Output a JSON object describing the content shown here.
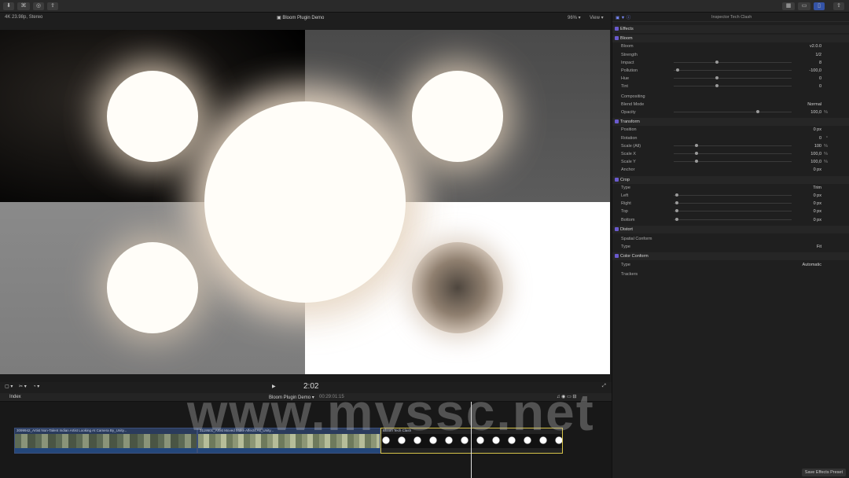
{
  "viewer": {
    "format": "4K 23.98p, Stereo",
    "title": "Bloom Plugin Demo",
    "zoom": "96%",
    "view_label": "View"
  },
  "inspector": {
    "title": "Inspector Tech Clash",
    "sections": [
      {
        "label": "Effects",
        "type": "section"
      },
      {
        "label": "Bloom",
        "type": "section"
      },
      {
        "label": "Bloom",
        "value": "v2.0.0"
      },
      {
        "label": "Strength",
        "value": "1/2"
      },
      {
        "label": "Impact",
        "value": "8"
      },
      {
        "label": "Pollution",
        "value": "-100,0"
      },
      {
        "label": "Hue",
        "value": "0"
      },
      {
        "label": "Tint",
        "value": "0"
      },
      {
        "label": "Compositing",
        "type": "sub"
      },
      {
        "label": "Blend Mode",
        "value": "Normal"
      },
      {
        "label": "Opacity",
        "value": "100,0",
        "unit": "%"
      },
      {
        "label": "Transform",
        "type": "section"
      },
      {
        "label": "Position",
        "value": "0 px"
      },
      {
        "label": "Rotation",
        "value": "0",
        "unit": "°"
      },
      {
        "label": "Scale (All)",
        "value": "100",
        "unit": "%"
      },
      {
        "label": "Scale X",
        "value": "100,0",
        "unit": "%"
      },
      {
        "label": "Scale Y",
        "value": "100,0",
        "unit": "%"
      },
      {
        "label": "Anchor",
        "value": "0 px"
      },
      {
        "label": "Crop",
        "type": "section"
      },
      {
        "label": "Type",
        "value": "Trim"
      },
      {
        "label": "Left",
        "value": "0 px"
      },
      {
        "label": "Right",
        "value": "0 px"
      },
      {
        "label": "Top",
        "value": "0 px"
      },
      {
        "label": "Bottom",
        "value": "0 px"
      },
      {
        "label": "Distort",
        "type": "section"
      },
      {
        "label": "Spatial Conform",
        "type": "sub"
      },
      {
        "label": "Type",
        "value": "Fit"
      },
      {
        "label": "Color Conform",
        "type": "section"
      },
      {
        "label": "Type",
        "value": "Automatic"
      },
      {
        "label": "Trackers",
        "type": "sub"
      }
    ],
    "save_preset": "Save Effects Preset"
  },
  "timeline": {
    "timecode": "2:02",
    "index_label": "Index",
    "project_name": "Bloom Plugin Demo",
    "project_time": "00:29:01:15",
    "clips": [
      {
        "title": "3099942_Artist Non-Talent Indian Artist Looking At Camera By_Unity..."
      },
      {
        "title": "3119501_Artist Moved Make Affects As_Unity..."
      },
      {
        "title": "Bloom Tech Clash"
      }
    ]
  },
  "watermark": "www.mvssc.net",
  "colors": {
    "accent": "#6a5acd",
    "clip_selected": "#d6c34a",
    "playhead": "#e0e0e0"
  }
}
